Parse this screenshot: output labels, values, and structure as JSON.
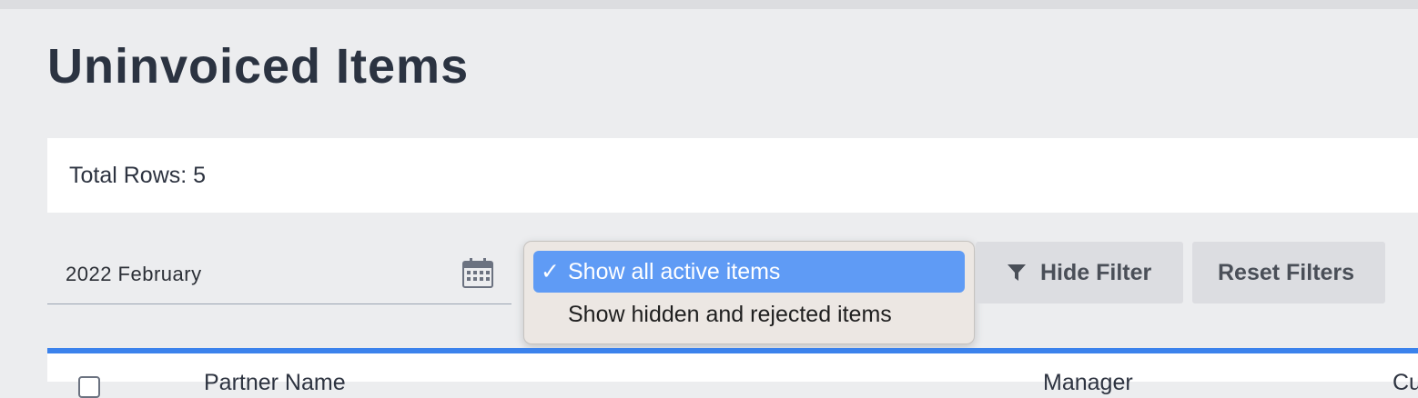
{
  "page": {
    "title": "Uninvoiced Items"
  },
  "summary": {
    "total_rows_text": "Total Rows: 5"
  },
  "filters": {
    "month_value": "2022 February",
    "calendar_icon": "calendar-icon",
    "visibility_options": [
      {
        "label": "Show all active items",
        "selected": true
      },
      {
        "label": "Show hidden and rejected items",
        "selected": false
      }
    ],
    "check_mark": "✓",
    "hide_filter_label": "Hide Filter",
    "reset_filters_label": "Reset Filters",
    "filter_icon": "funnel-icon"
  },
  "table": {
    "columns": [
      "Partner Name",
      "Manager",
      "Cu"
    ]
  },
  "colors": {
    "accent": "#3b82ec",
    "selected_option": "#5f9bf5",
    "button_bg": "#dcdde1",
    "page_bg": "#ecedef"
  }
}
